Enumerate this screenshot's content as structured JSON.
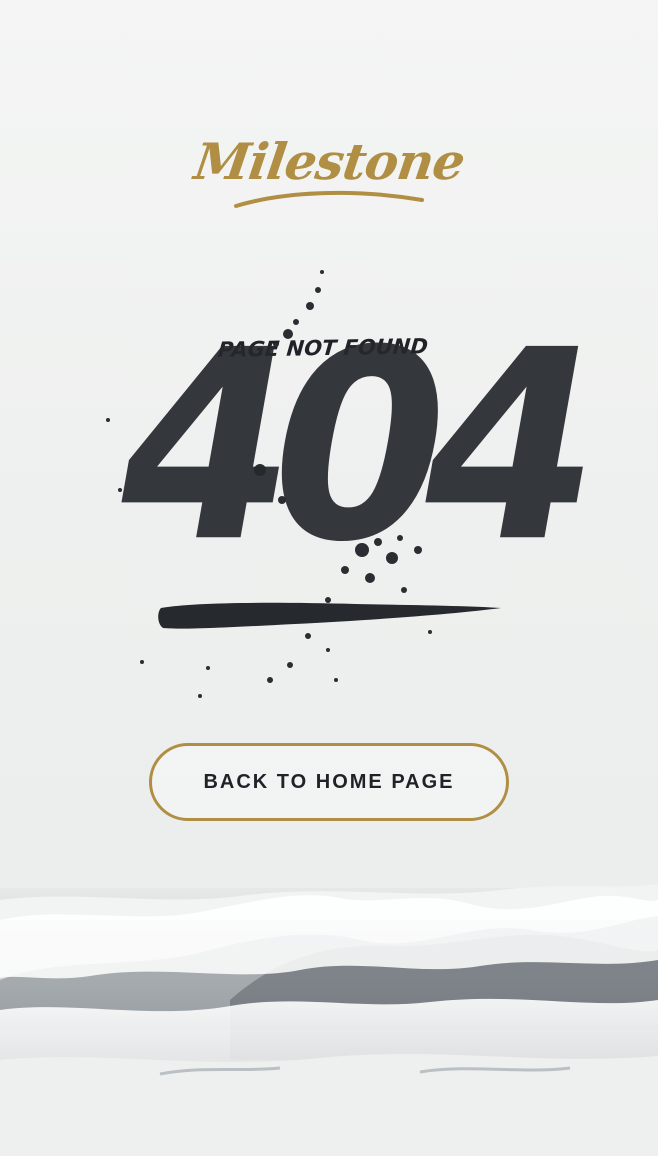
{
  "brand": {
    "logo_text": "Milestone",
    "logo_color": "#b08e43"
  },
  "error": {
    "subtitle": "PAGE NOT FOUND",
    "code": "404",
    "ink_color": "#25282d"
  },
  "actions": {
    "home_button_label": "BACK TO HOME PAGE",
    "button_border_color": "#b08e43"
  },
  "background": {
    "scene": "ocean-waves-photo",
    "sky_color": "#f1f2f1"
  }
}
